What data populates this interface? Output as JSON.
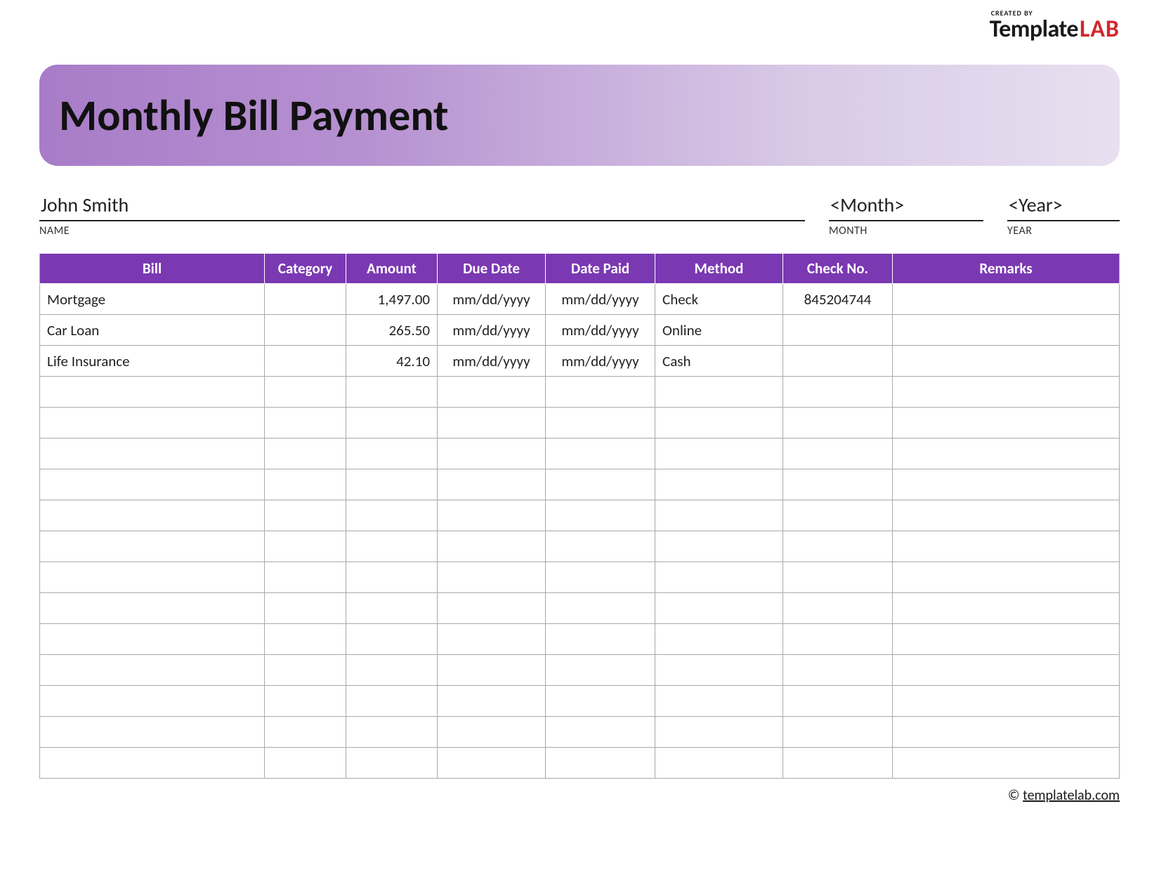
{
  "brand": {
    "created_by": "CREATED BY",
    "name_part1": "Template",
    "name_part2": "LAB"
  },
  "title": "Monthly Bill Payment",
  "meta": {
    "name": {
      "value": "John Smith",
      "label": "NAME"
    },
    "month": {
      "value": "<Month>",
      "label": "MONTH"
    },
    "year": {
      "value": "<Year>",
      "label": "YEAR"
    }
  },
  "columns": [
    "Bill",
    "Category",
    "Amount",
    "Due Date",
    "Date Paid",
    "Method",
    "Check No.",
    "Remarks"
  ],
  "rows": [
    {
      "bill": "Mortgage",
      "category": "",
      "amount": "1,497.00",
      "due": "mm/dd/yyyy",
      "paid": "mm/dd/yyyy",
      "method": "Check",
      "check": "845204744",
      "remarks": ""
    },
    {
      "bill": "Car Loan",
      "category": "",
      "amount": "265.50",
      "due": "mm/dd/yyyy",
      "paid": "mm/dd/yyyy",
      "method": "Online",
      "check": "",
      "remarks": ""
    },
    {
      "bill": "Life Insurance",
      "category": "",
      "amount": "42.10",
      "due": "mm/dd/yyyy",
      "paid": "mm/dd/yyyy",
      "method": "Cash",
      "check": "",
      "remarks": ""
    },
    {
      "bill": "",
      "category": "",
      "amount": "",
      "due": "",
      "paid": "",
      "method": "",
      "check": "",
      "remarks": ""
    },
    {
      "bill": "",
      "category": "",
      "amount": "",
      "due": "",
      "paid": "",
      "method": "",
      "check": "",
      "remarks": ""
    },
    {
      "bill": "",
      "category": "",
      "amount": "",
      "due": "",
      "paid": "",
      "method": "",
      "check": "",
      "remarks": ""
    },
    {
      "bill": "",
      "category": "",
      "amount": "",
      "due": "",
      "paid": "",
      "method": "",
      "check": "",
      "remarks": ""
    },
    {
      "bill": "",
      "category": "",
      "amount": "",
      "due": "",
      "paid": "",
      "method": "",
      "check": "",
      "remarks": ""
    },
    {
      "bill": "",
      "category": "",
      "amount": "",
      "due": "",
      "paid": "",
      "method": "",
      "check": "",
      "remarks": ""
    },
    {
      "bill": "",
      "category": "",
      "amount": "",
      "due": "",
      "paid": "",
      "method": "",
      "check": "",
      "remarks": ""
    },
    {
      "bill": "",
      "category": "",
      "amount": "",
      "due": "",
      "paid": "",
      "method": "",
      "check": "",
      "remarks": ""
    },
    {
      "bill": "",
      "category": "",
      "amount": "",
      "due": "",
      "paid": "",
      "method": "",
      "check": "",
      "remarks": ""
    },
    {
      "bill": "",
      "category": "",
      "amount": "",
      "due": "",
      "paid": "",
      "method": "",
      "check": "",
      "remarks": ""
    },
    {
      "bill": "",
      "category": "",
      "amount": "",
      "due": "",
      "paid": "",
      "method": "",
      "check": "",
      "remarks": ""
    },
    {
      "bill": "",
      "category": "",
      "amount": "",
      "due": "",
      "paid": "",
      "method": "",
      "check": "",
      "remarks": ""
    },
    {
      "bill": "",
      "category": "",
      "amount": "",
      "due": "",
      "paid": "",
      "method": "",
      "check": "",
      "remarks": ""
    }
  ],
  "footer": {
    "copyright": "©",
    "link_text": "templatelab.com"
  }
}
